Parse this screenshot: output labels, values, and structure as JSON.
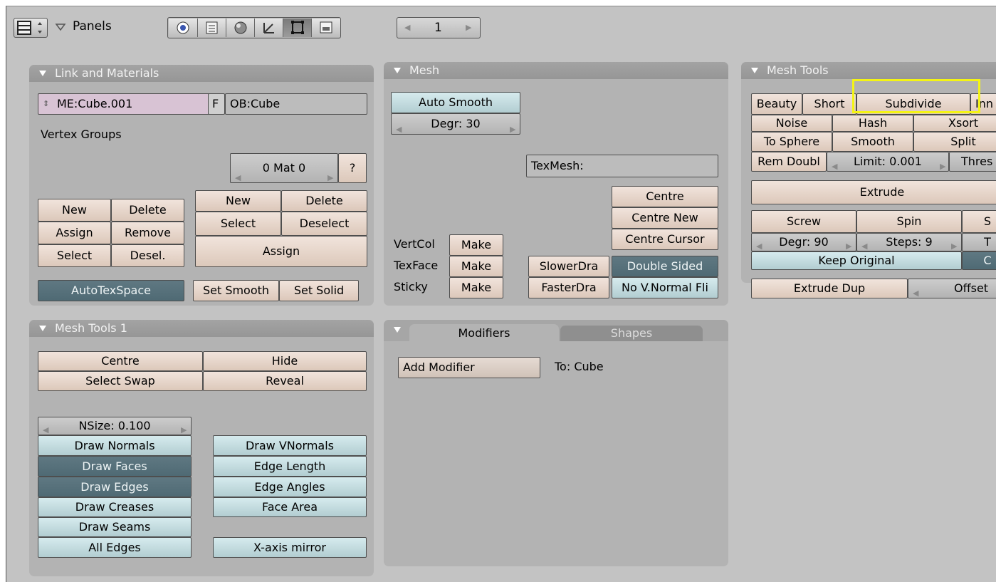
{
  "header": {
    "panels_label": "Panels",
    "frame_value": "1",
    "context_icons": [
      "logic-icon",
      "script-icon",
      "shading-icon",
      "object-icon",
      "editing-icon",
      "scene-icon"
    ]
  },
  "link_materials": {
    "title": "Link and Materials",
    "mesh_name": "ME:Cube.001",
    "fake_user": "F",
    "object_name": "OB:Cube",
    "vertex_groups_label": "Vertex Groups",
    "mat_value": "0 Mat 0",
    "mat_help": "?",
    "vg_new": "New",
    "vg_delete": "Delete",
    "vg_assign": "Assign",
    "vg_remove": "Remove",
    "vg_select": "Select",
    "vg_deselect": "Desel.",
    "mat_new": "New",
    "mat_delete": "Delete",
    "mat_select": "Select",
    "mat_deselect": "Deselect",
    "mat_assign": "Assign",
    "autotexspace": "AutoTexSpace",
    "set_smooth": "Set Smooth",
    "set_solid": "Set Solid"
  },
  "mesh": {
    "title": "Mesh",
    "auto_smooth": "Auto Smooth",
    "degr": "Degr: 30",
    "texmesh": "TexMesh:",
    "centre": "Centre",
    "centre_new": "Centre New",
    "centre_cursor": "Centre Cursor",
    "vertcol_label": "VertCol",
    "texface_label": "TexFace",
    "sticky_label": "Sticky",
    "make": "Make",
    "slower_draw": "SlowerDra",
    "faster_draw": "FasterDra",
    "double_sided": "Double Sided",
    "no_vnormal_flip": "No V.Normal Fli"
  },
  "mesh_tools": {
    "title": "Mesh Tools",
    "beauty": "Beauty",
    "short": "Short",
    "subdivide": "Subdivide",
    "innervert": "Inn",
    "noise": "Noise",
    "hash": "Hash",
    "xsort": "Xsort",
    "to_sphere": "To Sphere",
    "smooth": "Smooth",
    "split": "Split",
    "rem_doubles": "Rem Doubl",
    "limit": "Limit: 0.001",
    "threshold": "Thres",
    "extrude": "Extrude",
    "screw": "Screw",
    "spin": "Spin",
    "spin_dup": "S",
    "degr": "Degr: 90",
    "steps": "Steps: 9",
    "turns": "T",
    "keep_original": "Keep Original",
    "clockwise": "C",
    "extrude_dup": "Extrude Dup",
    "offset": "Offset"
  },
  "mesh_tools_1": {
    "title": "Mesh Tools 1",
    "centre": "Centre",
    "hide": "Hide",
    "select_swap": "Select Swap",
    "reveal": "Reveal",
    "nsize": "NSize: 0.100",
    "draw_normals": "Draw Normals",
    "draw_faces": "Draw Faces",
    "draw_edges": "Draw Edges",
    "draw_creases": "Draw Creases",
    "draw_seams": "Draw Seams",
    "all_edges": "All Edges",
    "draw_vnormals": "Draw VNormals",
    "edge_length": "Edge Length",
    "edge_angles": "Edge Angles",
    "face_area": "Face Area",
    "x_axis_mirror": "X-axis mirror"
  },
  "modifiers": {
    "tab_modifiers": "Modifiers",
    "tab_shapes": "Shapes",
    "add_modifier": "Add Modifier",
    "to_label": "To: Cube"
  },
  "colors": {
    "highlight": "#f4f414",
    "background": "#c3c3c3",
    "panel": "#b3b3b3"
  }
}
